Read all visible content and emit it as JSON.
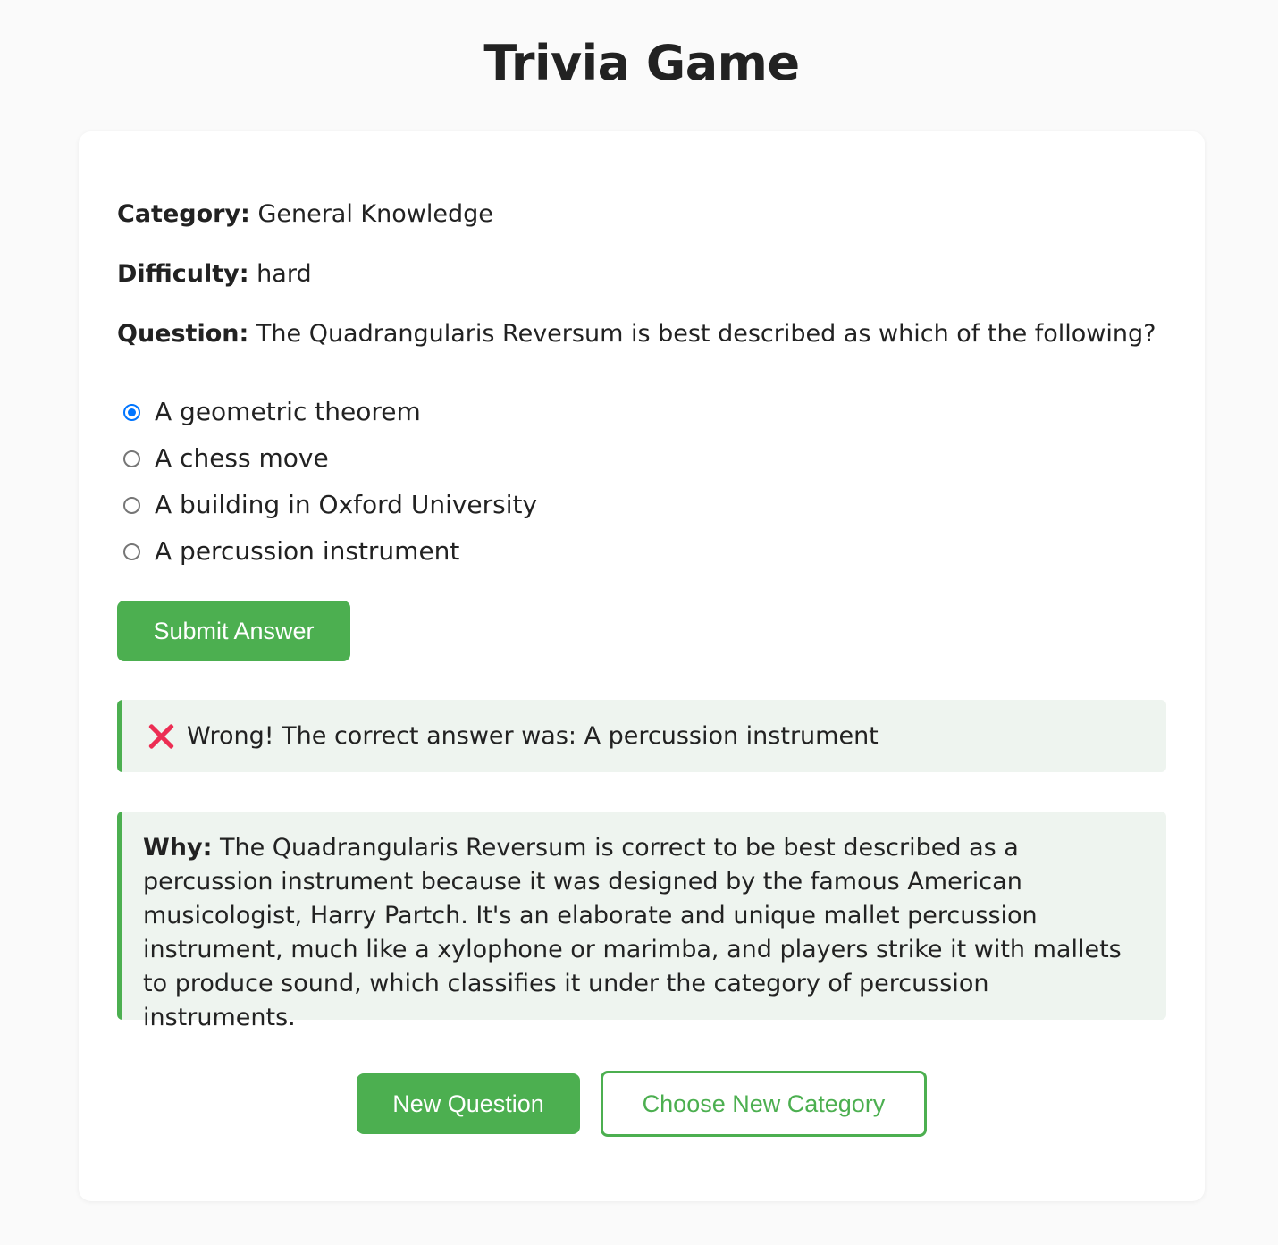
{
  "title": "Trivia Game",
  "meta": {
    "category_label": "Category:",
    "category_value": "General Knowledge",
    "difficulty_label": "Difficulty:",
    "difficulty_value": "hard",
    "question_label": "Question:",
    "question_value": "The Quadrangularis Reversum is best described as which of the following?"
  },
  "options": [
    {
      "label": "A geometric theorem",
      "selected": true
    },
    {
      "label": "A chess move",
      "selected": false
    },
    {
      "label": "A building in Oxford University",
      "selected": false
    },
    {
      "label": "A percussion instrument",
      "selected": false
    }
  ],
  "submit_label": "Submit Answer",
  "feedback": {
    "icon": "cross-mark-icon",
    "text": "Wrong! The correct answer was: A percussion instrument"
  },
  "explanation": {
    "label": "Why:",
    "text": "The Quadrangularis Reversum is correct to be best described as a percussion instrument because it was designed by the famous American musicologist, Harry Partch. It's an elaborate and unique mallet percussion instrument, much like a xylophone or marimba, and players strike it with mallets to produce sound, which classifies it under the category of percussion instruments."
  },
  "actions": {
    "new_question_label": "New Question",
    "choose_category_label": "Choose New Category"
  },
  "colors": {
    "accent": "#4caf50",
    "radio_selected": "#0075ff",
    "wrong_icon": "#ec2d53",
    "box_bg": "#eef4ef"
  }
}
